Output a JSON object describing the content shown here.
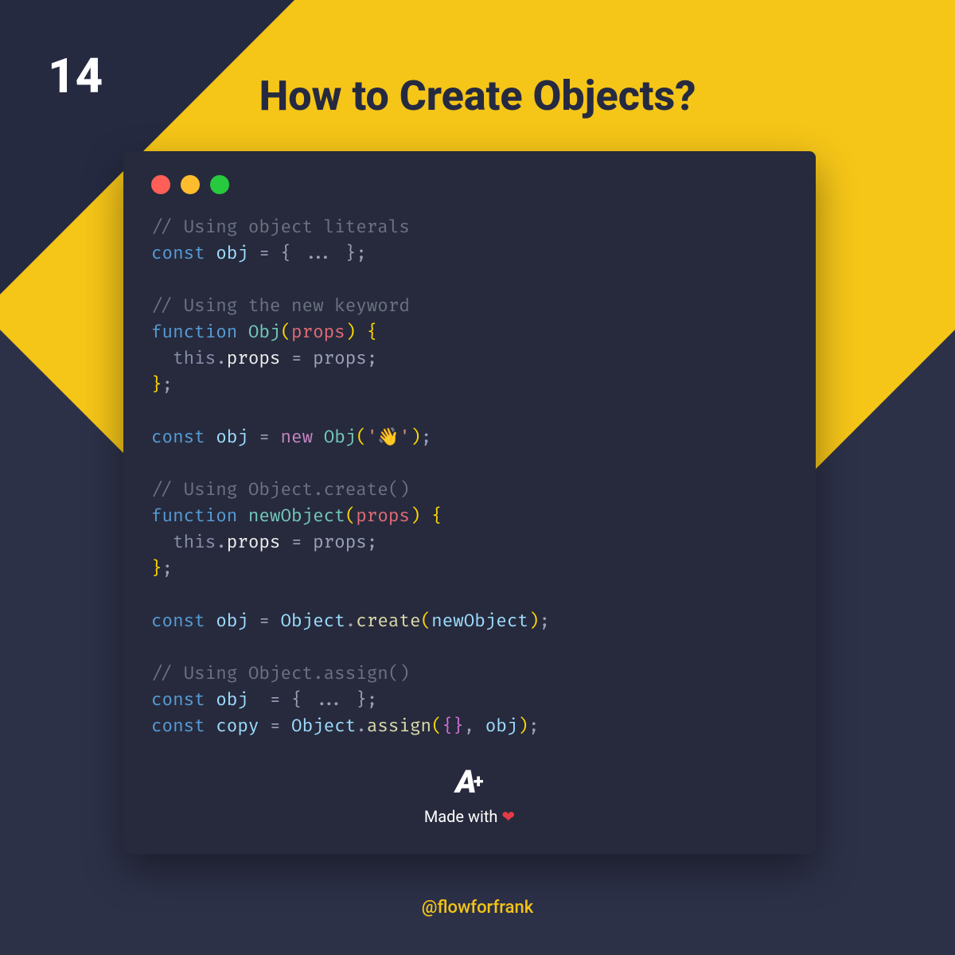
{
  "page_number": "14",
  "title": "How to Create Objects?",
  "code": {
    "c1": "// Using object literals",
    "l1_kw": "const",
    "l1_var": "obj",
    "l1_rest": " = { ... };",
    "c2": "// Using the new keyword",
    "l2_kw": "function",
    "l2_fn": "Obj",
    "l2_param": "props",
    "l3_this": "this",
    "l3_prop": "props",
    "l3_rest": " = props;",
    "l5_kw": "const",
    "l5_var": "obj",
    "l5_new": "new",
    "l5_fn": "Obj",
    "l5_arg": "'👋'",
    "c3": "// Using Object.create()",
    "l6_kw": "function",
    "l6_fn": "newObject",
    "l6_param": "props",
    "l9_kw": "const",
    "l9_var": "obj",
    "l9_obj": "Object",
    "l9_fn": "create",
    "l9_arg": "newObject",
    "c4": "// Using Object.assign()",
    "l10_kw": "const",
    "l10_var": "obj",
    "l10_rest": "  = { ... };",
    "l11_kw": "const",
    "l11_var": "copy",
    "l11_obj": "Object",
    "l11_fn": "assign",
    "l11_arg": "obj"
  },
  "footer": {
    "logo": "A",
    "plus": "+",
    "made": "Made with",
    "heart": "❤"
  },
  "handle": "@flowforfrank"
}
